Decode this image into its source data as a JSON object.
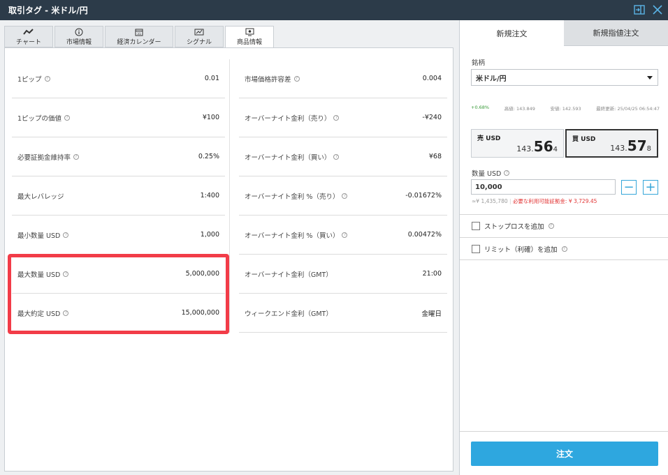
{
  "window": {
    "title": "取引タグ - 米ドル/円",
    "icons": [
      "dock-icon",
      "close-icon"
    ]
  },
  "tabs": [
    {
      "label": "チャート",
      "icon": "chart-line-icon"
    },
    {
      "label": "市場情報",
      "icon": "info-icon"
    },
    {
      "label": "経済カレンダー",
      "icon": "calendar-icon"
    },
    {
      "label": "シグナル",
      "icon": "signal-icon"
    },
    {
      "label": "商品情報",
      "icon": "product-info-icon",
      "active": true
    }
  ],
  "info_left": [
    {
      "label": "1ピップ",
      "value": "0.01",
      "help": true
    },
    {
      "label": "1ピップの価値",
      "value": "¥100",
      "help": true
    },
    {
      "label": "必要証拠金維持率",
      "value": "0.25%",
      "help": true
    },
    {
      "label": "最大レバレッジ",
      "value": "1:400",
      "help": false
    },
    {
      "label": "最小数量 USD",
      "value": "1,000",
      "help": true
    },
    {
      "label": "最大数量 USD",
      "value": "5,000,000",
      "help": true
    },
    {
      "label": "最大約定 USD",
      "value": "15,000,000",
      "help": true
    }
  ],
  "info_right": [
    {
      "label": "市場価格許容差",
      "value": "0.004",
      "help": true
    },
    {
      "label": "オーバーナイト金利（売り）",
      "value": "-¥240",
      "help": true
    },
    {
      "label": "オーバーナイト金利（買い）",
      "value": "¥68",
      "help": true
    },
    {
      "label": "オーバーナイト金利 %（売り）",
      "value": "-0.01672%",
      "help": true
    },
    {
      "label": "オーバーナイト金利 %（買い）",
      "value": "0.00472%",
      "help": true
    },
    {
      "label": "オーバーナイト金利（GMT）",
      "value": "21:00",
      "help": false
    },
    {
      "label": "ウィークエンド金利（GMT）",
      "value": "金曜日",
      "help": false
    }
  ],
  "order": {
    "tabs": [
      "新規注文",
      "新規指値注文"
    ],
    "symbol_label": "銘柄",
    "symbol": "米ドル/円",
    "stats": {
      "change": "+0.68%",
      "high_label": "高値:",
      "high": "143.849",
      "low_label": "安値:",
      "low": "142.593",
      "updated_label": "最終更新:",
      "updated": "25/04/25 06:54:47"
    },
    "sell": {
      "label": "売 USD",
      "prefix": "143.",
      "big": "56",
      "small": "4"
    },
    "buy": {
      "label": "買 USD",
      "prefix": "143.",
      "big": "57",
      "small": "8"
    },
    "qty_label": "数量 USD",
    "qty_value": "10,000",
    "qty_equiv": "≈¥ 1,435,780",
    "margin_note": "必要な利用可能証拠金: ¥ 3,729.45",
    "stoploss_label": "ストップロスを追加",
    "limit_label": "リミット（利確）を追加",
    "submit_label": "注文"
  },
  "colors": {
    "titlebar": "#2c3b49",
    "accent": "#2ea7df",
    "highlight": "#f23c48",
    "positive": "#3a9b3a",
    "warning": "#e23535"
  }
}
